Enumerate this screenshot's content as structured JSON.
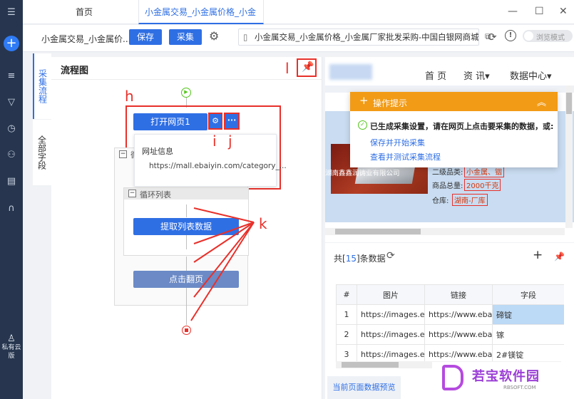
{
  "tabs": {
    "home": "首页",
    "active": "小金属交易_小金属价格_小金"
  },
  "toolbar": {
    "task_name": "小金属交易_小金属价...",
    "save_label": "保存",
    "collect_label": "采集",
    "url": "小金属交易_小金属价格_小金属厂家批发采购-中国白银网商城",
    "browse_mode": "浏览模式"
  },
  "side_tabs": {
    "collect_flow": "采集流程",
    "all_fields": "全部字段"
  },
  "flow": {
    "title": "流程图",
    "open_page": "打开网页1",
    "url_info_label": "网址信息",
    "url_info_value": "https://mall.ebaiyin.com/category_...",
    "loop_partial": "循",
    "loop_list": "循环列表",
    "extract": "提取列表数据",
    "next_page": "点击翻页"
  },
  "annotations": {
    "h": "h",
    "i": "i",
    "j": "j",
    "k": "k",
    "l": "l"
  },
  "website": {
    "nav_home": "首 页",
    "nav_news": "资 讯▾",
    "nav_data": "数据中心▾",
    "company": "湖南鑫鑫润铸业有限公司",
    "cat_label": "二级品类:",
    "cat_value": "小金属、铟",
    "total_label": "商品总量:",
    "total_value": "2000千克",
    "wh_label": "仓库:",
    "wh_value": "湖南-厂库"
  },
  "popup": {
    "title": "操作提示",
    "message": "已生成采集设置，请在网页上点击要采集的数据，或:",
    "link1": "保存并开始采集",
    "link2": "查看并测试采集流程"
  },
  "data_panel": {
    "count_prefix": "共[",
    "count": "15",
    "count_suffix": "]条数据",
    "preview_tab": "当前页面数据预览",
    "columns": [
      "#",
      "图片",
      "链接",
      "字段"
    ],
    "rows": [
      [
        "1",
        "https://images.e...",
        "https://www.eba...",
        "碲锭"
      ],
      [
        "2",
        "https://images.e...",
        "https://www.eba...",
        "镓"
      ],
      [
        "3",
        "https://images.e...",
        "https://www.eba...",
        "2#镁锭"
      ]
    ]
  },
  "rail": {
    "cloud": "私有云版"
  },
  "watermark": {
    "title": "若宝软件园",
    "sub": "RBSOFT.COM"
  }
}
